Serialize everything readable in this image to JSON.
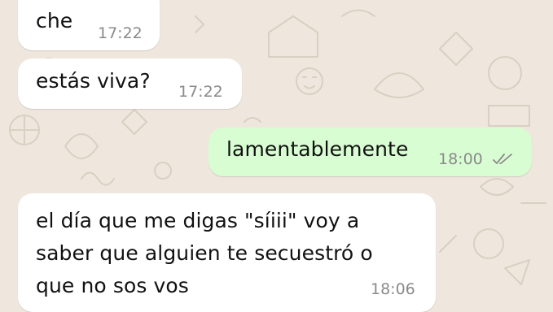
{
  "messages": [
    {
      "direction": "incoming",
      "text": "che",
      "time": "17:22"
    },
    {
      "direction": "incoming",
      "text": "estás viva?",
      "time": "17:22"
    },
    {
      "direction": "outgoing",
      "text": "lamentablemente",
      "time": "18:00",
      "status": "read",
      "status_icon": "double-check-icon"
    },
    {
      "direction": "incoming",
      "text": "el día que me digas \"síiii\" voy a\nsaber que alguien te secuestró o\nque no sos vos",
      "time": "18:06"
    }
  ],
  "colors": {
    "chat_background": "#efe7dd",
    "incoming_bubble": "#ffffff",
    "outgoing_bubble": "#d9fdd3",
    "timestamp": "#8a8a8a",
    "read_ticks": "#8a8a8a"
  }
}
